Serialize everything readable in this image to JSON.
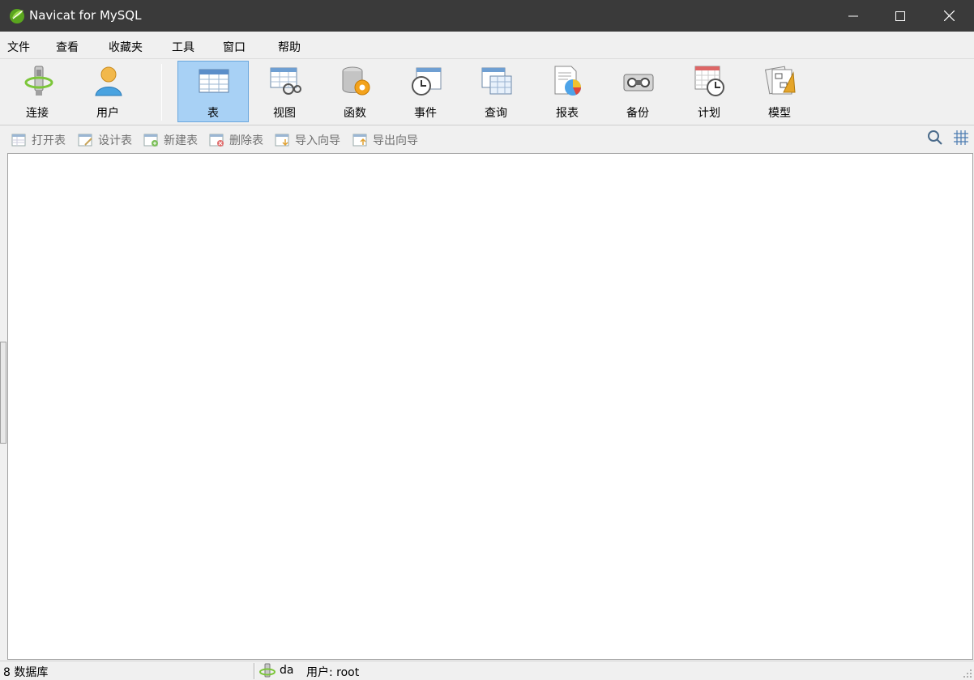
{
  "window": {
    "title": "Navicat for MySQL",
    "logo_icon": "navicat-leaf-icon",
    "buttons": [
      "minimize-icon",
      "maximize-icon",
      "close-icon"
    ]
  },
  "menu": {
    "items": [
      "文件",
      "查看",
      "收藏夹",
      "工具",
      "窗口",
      "帮助"
    ]
  },
  "toolbar": {
    "items": [
      {
        "label": "连接",
        "icon": "connection-icon",
        "active": false
      },
      {
        "label": "用户",
        "icon": "user-icon",
        "active": false
      },
      {
        "label": "表",
        "icon": "table-icon",
        "active": true
      },
      {
        "label": "视图",
        "icon": "view-icon",
        "active": false
      },
      {
        "label": "函数",
        "icon": "function-icon",
        "active": false
      },
      {
        "label": "事件",
        "icon": "event-icon",
        "active": false
      },
      {
        "label": "查询",
        "icon": "query-icon",
        "active": false
      },
      {
        "label": "报表",
        "icon": "report-icon",
        "active": false
      },
      {
        "label": "备份",
        "icon": "backup-icon",
        "active": false
      },
      {
        "label": "计划",
        "icon": "schedule-icon",
        "active": false
      },
      {
        "label": "模型",
        "icon": "model-icon",
        "active": false
      }
    ]
  },
  "subtoolbar": {
    "items": [
      {
        "label": "打开表",
        "icon": "open-table-icon"
      },
      {
        "label": "设计表",
        "icon": "design-table-icon"
      },
      {
        "label": "新建表",
        "icon": "new-table-icon"
      },
      {
        "label": "删除表",
        "icon": "delete-table-icon"
      },
      {
        "label": "导入向导",
        "icon": "import-wizard-icon"
      },
      {
        "label": "导出向导",
        "icon": "export-wizard-icon"
      }
    ],
    "right_icons": [
      "search-icon",
      "grid-view-icon"
    ]
  },
  "status": {
    "databases": "8 数据库",
    "connection": "da",
    "user": "用户: root"
  },
  "colors": {
    "titlebar": "#3a3a3a",
    "active_tool": "#a8d1f5",
    "active_border": "#6aa7dd"
  }
}
